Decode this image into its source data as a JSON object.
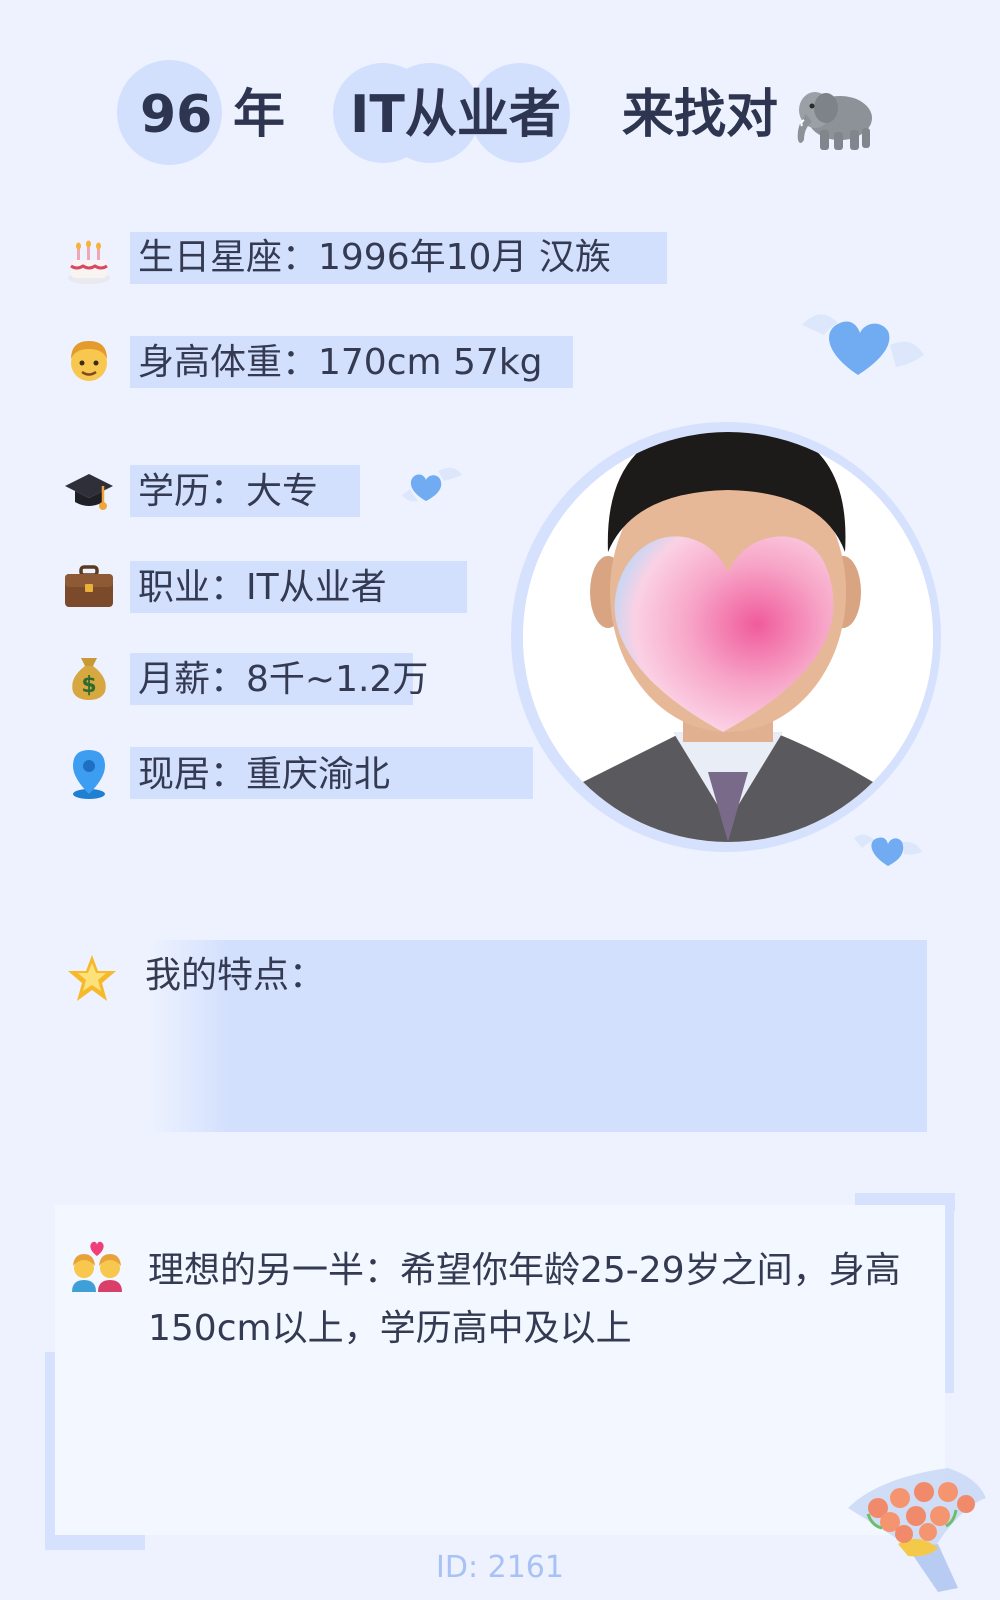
{
  "header": {
    "year_num": "96",
    "year_unit": "年",
    "occupation": "IT从业者",
    "looking": "来找对",
    "animal_icon": "elephant-icon"
  },
  "info_rows": [
    {
      "icon": "cake-icon",
      "text": "生日星座：1996年10月 汉族"
    },
    {
      "icon": "man-icon",
      "text": "身高体重：170cm 57kg"
    },
    {
      "icon": "graduation-cap-icon",
      "text": "学历：大专"
    },
    {
      "icon": "briefcase-icon",
      "text": "职业：IT从业者"
    },
    {
      "icon": "money-bag-icon",
      "text": "月薪：8千~1.2万"
    },
    {
      "icon": "location-pin-icon",
      "text": "现居：重庆渝北"
    }
  ],
  "features": {
    "icon": "star-icon",
    "label": "我的特点："
  },
  "ideal_partner": {
    "icon": "couple-heart-icon",
    "text": "理想的另一半：希望你年龄25-29岁之间，身高150cm以上，学历高中及以上"
  },
  "profile_id": "ID: 2161",
  "colors": {
    "accent": "#d3e0fd",
    "text": "#2e3550",
    "background": "#edf2fe",
    "id_text": "#a8c2f5"
  }
}
